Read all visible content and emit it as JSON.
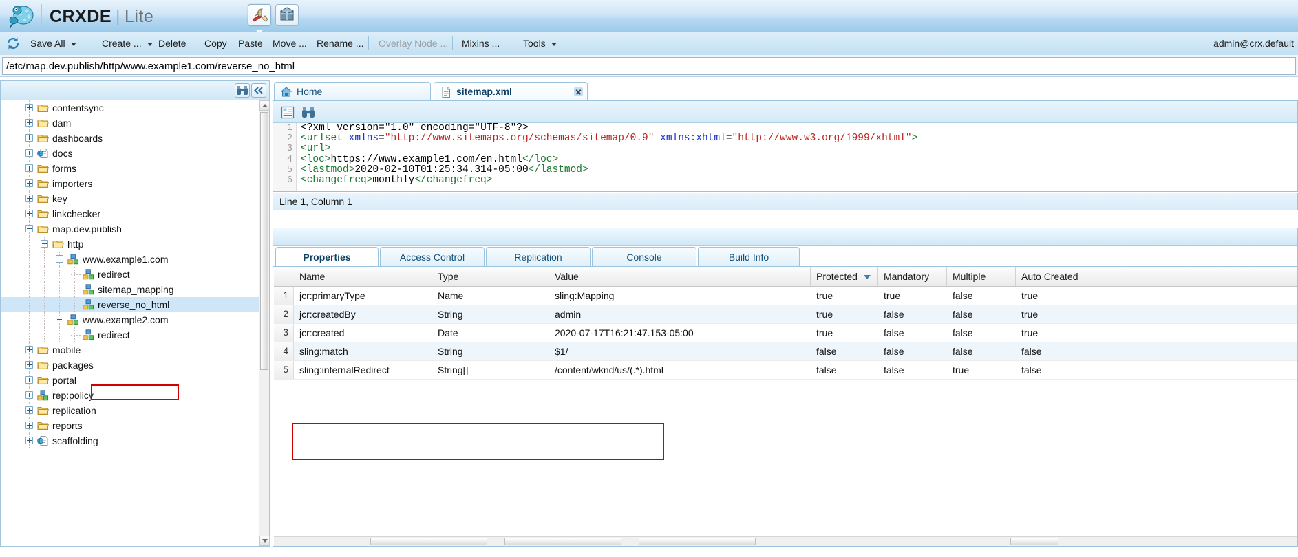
{
  "header": {
    "brand_bold": "CRXDE",
    "brand_sep": "|",
    "brand_light": "Lite",
    "logo_icon": "crx-mascot-icon",
    "tools": [
      {
        "name": "wrench-tools-icon",
        "active": true
      },
      {
        "name": "package-manager-icon",
        "active": false
      }
    ]
  },
  "menubar": {
    "refresh_icon": "refresh-icon",
    "items": [
      {
        "label": "Save All",
        "caret": true,
        "disabled": false
      },
      {
        "label": "Create ...",
        "caret": true,
        "disabled": false
      },
      {
        "label": "Delete",
        "caret": false,
        "disabled": false
      },
      {
        "label": "Copy",
        "caret": false,
        "disabled": false
      },
      {
        "label": "Paste",
        "caret": false,
        "disabled": false
      },
      {
        "label": "Move ...",
        "caret": false,
        "disabled": false
      },
      {
        "label": "Rename ...",
        "caret": false,
        "disabled": false
      },
      {
        "label": "Overlay Node ...",
        "caret": false,
        "disabled": true
      },
      {
        "label": "Mixins ...",
        "caret": false,
        "disabled": false
      },
      {
        "label": "Tools",
        "caret": true,
        "disabled": false
      }
    ],
    "user": "admin@crx.default"
  },
  "path": {
    "value": "/etc/map.dev.publish/http/www.example1.com/reverse_no_html",
    "placeholder": "/"
  },
  "tree": {
    "find_icon": "binoculars-icon",
    "collapse_icon": "collapse-all-icon",
    "nodes": [
      {
        "label": "contentsync",
        "depth": 1,
        "toggle": "plus",
        "icon": "folder-icon",
        "selected": false
      },
      {
        "label": "dam",
        "depth": 1,
        "toggle": "plus",
        "icon": "folder-icon",
        "selected": false
      },
      {
        "label": "dashboards",
        "depth": 1,
        "toggle": "plus",
        "icon": "folder-icon",
        "selected": false
      },
      {
        "label": "docs",
        "depth": 1,
        "toggle": "plus",
        "icon": "page-globe-icon",
        "selected": false
      },
      {
        "label": "forms",
        "depth": 1,
        "toggle": "plus",
        "icon": "folder-icon",
        "selected": false
      },
      {
        "label": "importers",
        "depth": 1,
        "toggle": "plus",
        "icon": "folder-icon",
        "selected": false
      },
      {
        "label": "key",
        "depth": 1,
        "toggle": "plus",
        "icon": "folder-icon",
        "selected": false
      },
      {
        "label": "linkchecker",
        "depth": 1,
        "toggle": "plus",
        "icon": "folder-icon",
        "selected": false
      },
      {
        "label": "map.dev.publish",
        "depth": 1,
        "toggle": "minus",
        "icon": "folder-icon",
        "selected": false
      },
      {
        "label": "http",
        "depth": 2,
        "toggle": "minus",
        "icon": "folder-icon",
        "selected": false
      },
      {
        "label": "www.example1.com",
        "depth": 3,
        "toggle": "minus",
        "icon": "nodes-icon",
        "selected": false
      },
      {
        "label": "redirect",
        "depth": 4,
        "toggle": "none",
        "icon": "nodes-icon",
        "selected": false
      },
      {
        "label": "sitemap_mapping",
        "depth": 4,
        "toggle": "none",
        "icon": "nodes-icon",
        "selected": false
      },
      {
        "label": "reverse_no_html",
        "depth": 4,
        "toggle": "none",
        "icon": "nodes-icon",
        "selected": true
      },
      {
        "label": "www.example2.com",
        "depth": 3,
        "toggle": "minus",
        "icon": "nodes-icon",
        "selected": false
      },
      {
        "label": "redirect",
        "depth": 4,
        "toggle": "none",
        "icon": "nodes-icon",
        "selected": false
      },
      {
        "label": "mobile",
        "depth": 1,
        "toggle": "plus",
        "icon": "folder-icon",
        "selected": false
      },
      {
        "label": "packages",
        "depth": 1,
        "toggle": "plus",
        "icon": "folder-icon",
        "selected": false
      },
      {
        "label": "portal",
        "depth": 1,
        "toggle": "plus",
        "icon": "folder-icon",
        "selected": false
      },
      {
        "label": "rep:policy",
        "depth": 1,
        "toggle": "plus",
        "icon": "nodes-icon",
        "selected": false
      },
      {
        "label": "replication",
        "depth": 1,
        "toggle": "plus",
        "icon": "folder-icon",
        "selected": false
      },
      {
        "label": "reports",
        "depth": 1,
        "toggle": "plus",
        "icon": "folder-icon",
        "selected": false
      },
      {
        "label": "scaffolding",
        "depth": 1,
        "toggle": "plus",
        "icon": "page-globe-icon",
        "selected": false
      }
    ]
  },
  "editor": {
    "tabs": [
      {
        "label": "Home",
        "icon": "home-icon",
        "active": false,
        "closable": false
      },
      {
        "label": "sitemap.xml",
        "icon": "xml-file-icon",
        "active": true,
        "closable": true
      }
    ],
    "toolbar": [
      {
        "name": "outline-icon"
      },
      {
        "name": "find-icon"
      }
    ],
    "line_numbers": [
      "1",
      "2",
      "3",
      "4",
      "5",
      "6"
    ],
    "lines": [
      [
        {
          "t": "&lt;?xml ",
          "c": "pl"
        },
        {
          "t": "version",
          "c": "pl"
        },
        {
          "t": "=",
          "c": "pl"
        },
        {
          "t": "\"1.0\"",
          "c": "pl"
        },
        {
          "t": " encoding",
          "c": "pl"
        },
        {
          "t": "=",
          "c": "pl"
        },
        {
          "t": "\"UTF-8\"?&gt;",
          "c": "pl"
        }
      ],
      [
        {
          "t": "&lt;urlset ",
          "c": "tg"
        },
        {
          "t": "xmlns",
          "c": "at"
        },
        {
          "t": "=",
          "c": "pl"
        },
        {
          "t": "\"http://www.sitemaps.org/schemas/sitemap/0.9\"",
          "c": "st"
        },
        {
          "t": " xmlns:xhtml",
          "c": "at"
        },
        {
          "t": "=",
          "c": "pl"
        },
        {
          "t": "\"http://www.w3.org/1999/xhtml\"",
          "c": "st"
        },
        {
          "t": "&gt;",
          "c": "tg"
        }
      ],
      [
        {
          "t": "&lt;url&gt;",
          "c": "tg"
        }
      ],
      [
        {
          "t": "&lt;loc&gt;",
          "c": "tg"
        },
        {
          "t": "https://www.example1.com/en.html",
          "c": "pl"
        },
        {
          "t": "&lt;/loc&gt;",
          "c": "tg"
        }
      ],
      [
        {
          "t": "&lt;lastmod&gt;",
          "c": "tg"
        },
        {
          "t": "2020-02-10T01:25:34.314-05:00",
          "c": "pl"
        },
        {
          "t": "&lt;/lastmod&gt;",
          "c": "tg"
        }
      ],
      [
        {
          "t": "&lt;changefreq&gt;",
          "c": "tg"
        },
        {
          "t": "monthly",
          "c": "pl"
        },
        {
          "t": "&lt;/changefreq&gt;",
          "c": "tg"
        }
      ]
    ],
    "status": "Line 1, Column 1"
  },
  "properties_panel": {
    "tabs": [
      {
        "label": "Properties",
        "active": true
      },
      {
        "label": "Access Control",
        "active": false
      },
      {
        "label": "Replication",
        "active": false
      },
      {
        "label": "Console",
        "active": false
      },
      {
        "label": "Build Info",
        "active": false
      }
    ],
    "columns": [
      {
        "label": "Name",
        "sorted": false
      },
      {
        "label": "Type",
        "sorted": false
      },
      {
        "label": "Value",
        "sorted": false
      },
      {
        "label": "Protected",
        "sorted": true
      },
      {
        "label": "Mandatory",
        "sorted": false
      },
      {
        "label": "Multiple",
        "sorted": false
      },
      {
        "label": "Auto Created",
        "sorted": false
      }
    ],
    "rows": [
      {
        "n": "1",
        "name": "jcr:primaryType",
        "type": "Name",
        "value": "sling:Mapping",
        "protected": "true",
        "mandatory": "true",
        "multiple": "false",
        "auto_created": "true"
      },
      {
        "n": "2",
        "name": "jcr:createdBy",
        "type": "String",
        "value": "admin",
        "protected": "true",
        "mandatory": "false",
        "multiple": "false",
        "auto_created": "true"
      },
      {
        "n": "3",
        "name": "jcr:created",
        "type": "Date",
        "value": "2020-07-17T16:21:47.153-05:00",
        "protected": "true",
        "mandatory": "false",
        "multiple": "false",
        "auto_created": "true"
      },
      {
        "n": "4",
        "name": "sling:match",
        "type": "String",
        "value": "$1/",
        "protected": "false",
        "mandatory": "false",
        "multiple": "false",
        "auto_created": "false"
      },
      {
        "n": "5",
        "name": "sling:internalRedirect",
        "type": "String[]",
        "value": "/content/wknd/us/(.*).html",
        "protected": "false",
        "mandatory": "false",
        "multiple": "true",
        "auto_created": "false"
      }
    ]
  },
  "annotations": {
    "tree_highlight_color": "#d40000",
    "props_highlight_color": "#d40000"
  }
}
